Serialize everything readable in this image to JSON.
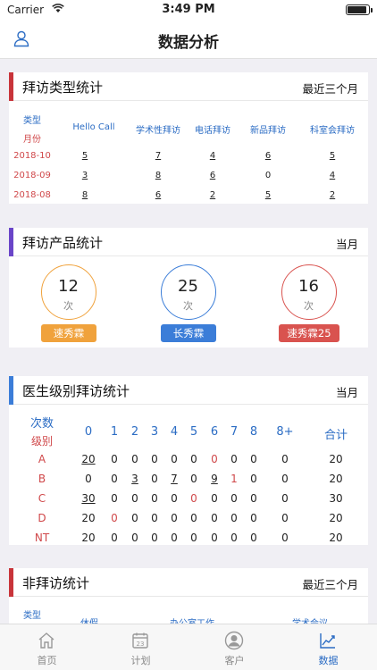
{
  "status": {
    "carrier": "Carrier",
    "time": "3:49 PM",
    "battery_level": 0.9
  },
  "nav": {
    "title": "数据分析"
  },
  "visit_type": {
    "title": "拜访类型统计",
    "range": "最近三个月",
    "corner_top": "类型",
    "corner_bottom": "月份",
    "columns": [
      "Hello Call",
      "学术性拜访",
      "电话拜访",
      "新品拜访",
      "科室会拜访"
    ],
    "rows": [
      {
        "month": "2018-10",
        "values": [
          "5",
          "7",
          "4",
          "6",
          "5"
        ]
      },
      {
        "month": "2018-09",
        "values": [
          "3",
          "8",
          "6",
          "0",
          "4"
        ]
      },
      {
        "month": "2018-08",
        "values": [
          "8",
          "6",
          "2",
          "5",
          "2"
        ]
      }
    ]
  },
  "visit_product": {
    "title": "拜访产品统计",
    "range": "当月",
    "items": [
      {
        "count": "12",
        "unit": "次",
        "product": "速秀霖",
        "color": "#f0a23c"
      },
      {
        "count": "25",
        "unit": "次",
        "product": "长秀霖",
        "color": "#3b7dd8"
      },
      {
        "count": "16",
        "unit": "次",
        "product": "速秀霖25",
        "color": "#d9534f"
      }
    ]
  },
  "doctor_level": {
    "title": "医生级别拜访统计",
    "range": "当月",
    "corner_top": "次数",
    "corner_bottom": "级别",
    "headers": [
      "0",
      "1",
      "2",
      "3",
      "4",
      "5",
      "6",
      "7",
      "8",
      "8+"
    ],
    "total_label": "合计",
    "rows": [
      {
        "level": "A",
        "values": [
          "20",
          "0",
          "0",
          "0",
          "0",
          "0",
          "0",
          "0",
          "0",
          "0"
        ],
        "total": "20"
      },
      {
        "level": "B",
        "values": [
          "0",
          "0",
          "3",
          "0",
          "7",
          "0",
          "9",
          "1",
          "0",
          "0"
        ],
        "total": "20"
      },
      {
        "level": "C",
        "values": [
          "30",
          "0",
          "0",
          "0",
          "0",
          "0",
          "0",
          "0",
          "0",
          "0"
        ],
        "total": "30"
      },
      {
        "level": "D",
        "values": [
          "20",
          "0",
          "0",
          "0",
          "0",
          "0",
          "0",
          "0",
          "0",
          "0"
        ],
        "total": "20"
      },
      {
        "level": "NT",
        "values": [
          "20",
          "0",
          "0",
          "0",
          "0",
          "0",
          "0",
          "0",
          "0",
          "0"
        ],
        "total": "20"
      }
    ]
  },
  "non_visit": {
    "title": "非拜访统计",
    "range": "最近三个月",
    "corner_top": "类型",
    "columns": [
      "休假",
      "办公室工作",
      "学术会议"
    ]
  },
  "tabs": [
    {
      "label": "首页",
      "icon": "home-icon"
    },
    {
      "label": "计划",
      "icon": "calendar-icon",
      "day": "23"
    },
    {
      "label": "客户",
      "icon": "customer-icon"
    },
    {
      "label": "数据",
      "icon": "chart-icon",
      "active": true
    }
  ],
  "colors": {
    "accent": "#2b6cc4",
    "red": "#d0484a"
  }
}
